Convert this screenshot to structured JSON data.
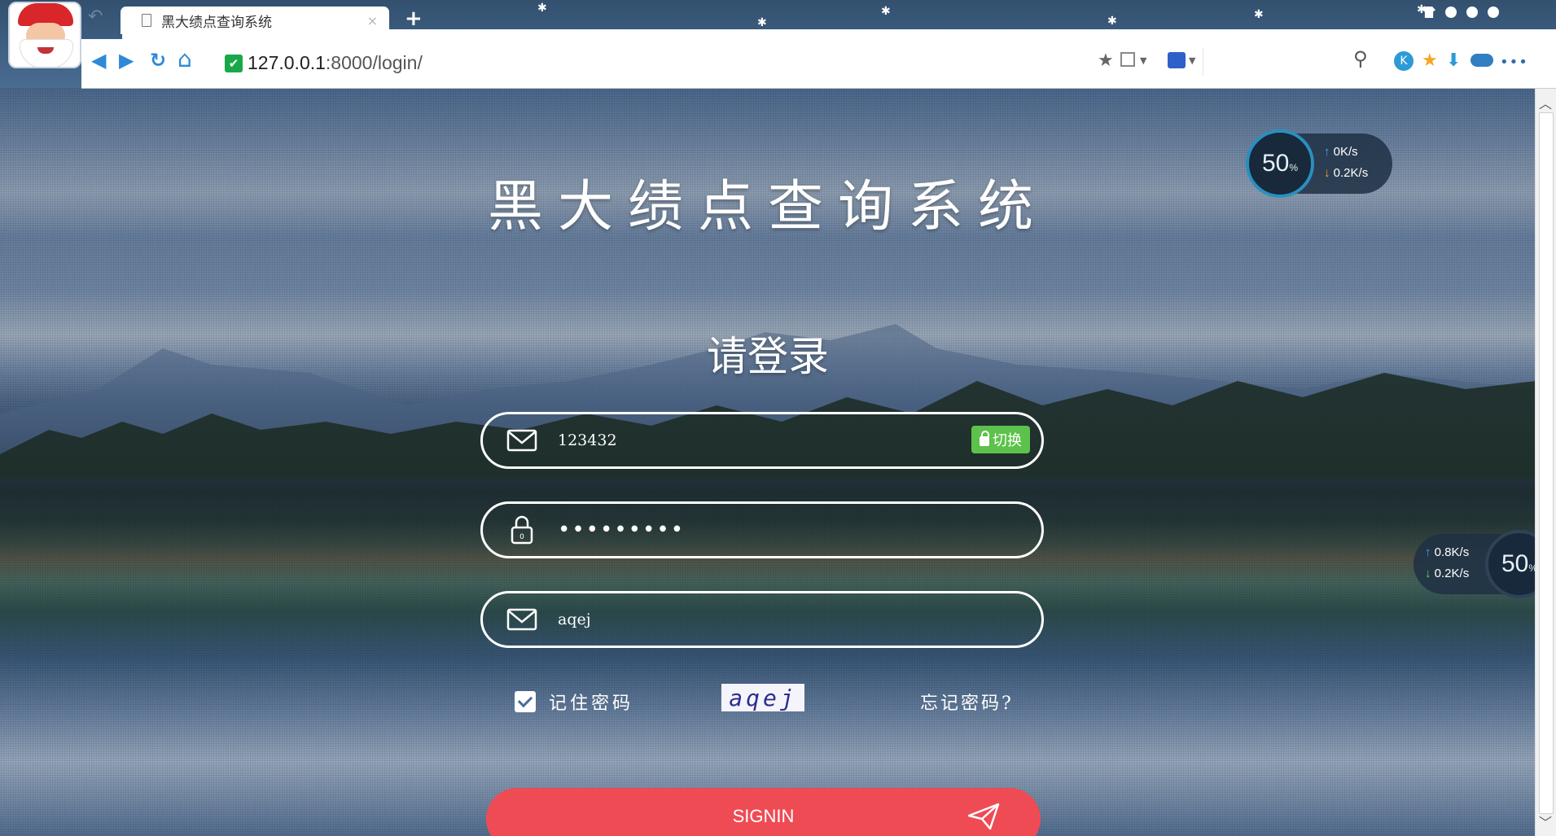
{
  "browser": {
    "tab_title": "黑大绩点查询系统",
    "tab_close": "×",
    "new_tab": "+",
    "url_host": "127.0.0.1",
    "url_path": ":8000/login/",
    "secure_check": "✔"
  },
  "page": {
    "system_title": "黑大绩点查询系统",
    "login_title": "请登录",
    "username_value": "123432",
    "switch_label": "切换",
    "password_value": "•••••••••",
    "captcha_input_value": "aqej",
    "remember_label": "记住密码",
    "captcha_image_text": "aqej",
    "forgot_label": "忘记密码?",
    "signin_label": "SIGNIN"
  },
  "widgets": {
    "speed_top": {
      "percent": "50",
      "unit": "%",
      "up": "0K/s",
      "down": "0.2K/s"
    },
    "speed_right": {
      "percent": "50",
      "unit": "%",
      "up": "0.8K/s",
      "down": "0.2K/s"
    }
  },
  "icons": {
    "back": "◀",
    "forward": "▶",
    "refresh": "↻",
    "home": "⌂",
    "star": "★",
    "search": "⚲",
    "download": "⬇",
    "more": "•••"
  }
}
